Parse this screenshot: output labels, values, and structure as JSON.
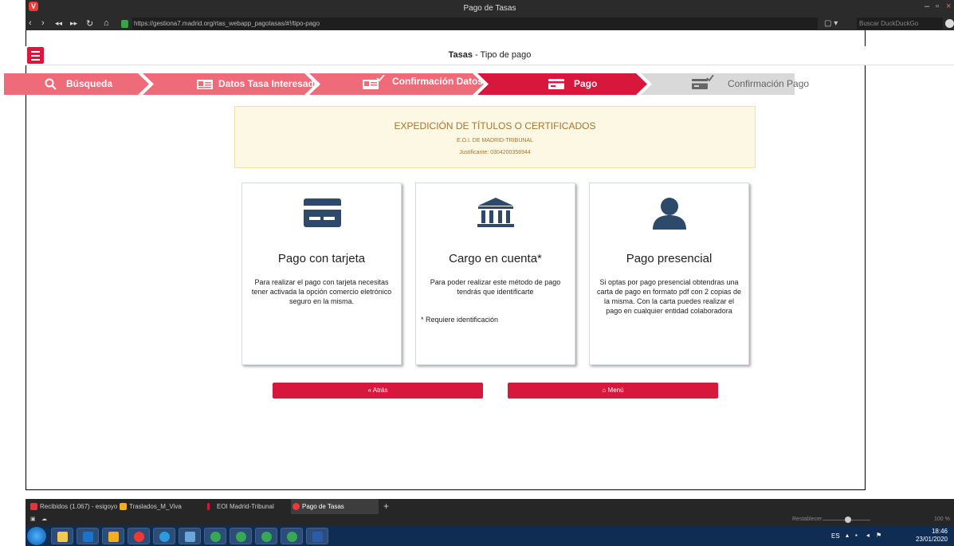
{
  "browser": {
    "window_title": "Pago de Tasas",
    "url": "https://gestiona7.madrid.org/rtas_webapp_pagotasas/#!/tipo-pago",
    "search_placeholder": "Buscar DuckDuckGo"
  },
  "app": {
    "title_bold": "Tasas",
    "title_rest": " - Tipo de pago"
  },
  "steps": [
    {
      "label": "Búsqueda",
      "color": "#ef6b7a",
      "icon": "search-icon"
    },
    {
      "label": "Datos Tasa Interesado",
      "color": "#ef6b7a",
      "icon": "id-card-icon"
    },
    {
      "label": "Confirmación Datos",
      "color": "#ef6b7a",
      "icon": "id-card-check-icon"
    },
    {
      "label": "Pago",
      "color": "#d7173b",
      "icon": "credit-card-icon"
    },
    {
      "label": "Confirmación Pago",
      "color": "#d9d9d9",
      "icon": "credit-card-check-icon"
    }
  ],
  "fee": {
    "title": "EXPEDICIÓN DE TÍTULOS O CERTIFICADOS",
    "subtitle": "E.O.I. DE MADRID-TRIBUNAL",
    "justificante": "Justificante: 0304200358944"
  },
  "options": [
    {
      "title": "Pago con tarjeta",
      "text": "Para realizar el pago con tarjeta necesitas tener activada la opción comercio eletrónico seguro en la misma.",
      "note": "",
      "icon": "credit-card-icon"
    },
    {
      "title": "Cargo en cuenta*",
      "text": "Para poder realizar este método de pago tendrás que identificarte",
      "note": "* Requiere identificación",
      "icon": "bank-icon"
    },
    {
      "title": "Pago presencial",
      "text": "Si optas por pago presencial obtendras una carta de pago en formato pdf con 2 copias de la misma. Con la carta puedes realizar el pago en cualquier entidad colaboradora",
      "note": "",
      "icon": "user-icon"
    }
  ],
  "buttons": {
    "back": "Atrás",
    "menu": "Menú"
  },
  "tabs": [
    {
      "label": "Recibidos (1.067) - esigoyo",
      "color": "#e0353c"
    },
    {
      "label": "Traslados_M_Viva",
      "color": "#f2b01e"
    },
    {
      "label": "EOI Madrid-Tribunal",
      "color": "#d7173b"
    },
    {
      "label": "Pago de Tasas",
      "color": "#ef3939"
    }
  ],
  "status": {
    "reset": "Restablecer",
    "zoom": "100 %"
  },
  "taskbar": {
    "lang": "ES",
    "time": "18:46",
    "date": "23/01/2020",
    "apps": [
      "explorer",
      "outlook",
      "notes",
      "vivaldi",
      "chrome",
      "files",
      "chrome-profile-1",
      "chrome-profile-2",
      "chrome-profile-3",
      "chrome-profile-4",
      "word"
    ]
  }
}
